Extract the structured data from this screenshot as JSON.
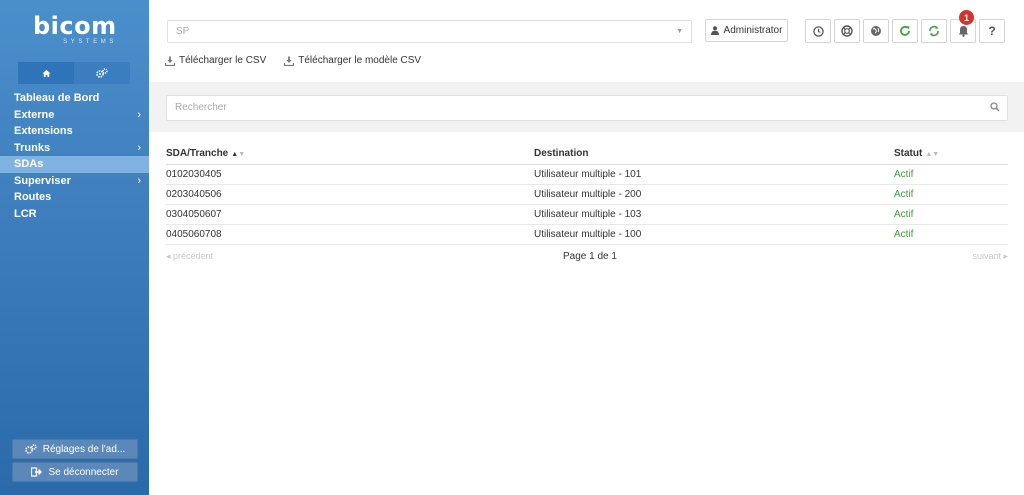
{
  "brand": {
    "name": "bicom",
    "subtitle": "SYSTEMS"
  },
  "sidebar": {
    "tabs": [
      {
        "icon": "home-icon"
      },
      {
        "icon": "gears-icon"
      }
    ],
    "items": [
      {
        "label": "Tableau de Bord",
        "has_children": false,
        "active": false
      },
      {
        "label": "Externe",
        "has_children": true,
        "active": false
      },
      {
        "label": "Extensions",
        "has_children": false,
        "active": false
      },
      {
        "label": "Trunks",
        "has_children": true,
        "active": false
      },
      {
        "label": "SDAs",
        "has_children": false,
        "active": true
      },
      {
        "label": "Superviser",
        "has_children": true,
        "active": false
      },
      {
        "label": "Routes",
        "has_children": false,
        "active": false
      },
      {
        "label": "LCR",
        "has_children": false,
        "active": false
      }
    ],
    "settings_label": "Réglages de l'ad...",
    "logout_label": "Se déconnecter"
  },
  "header": {
    "tenant_value": "SP",
    "admin_label": "Administrator",
    "icons": [
      "clock-icon",
      "lifebuoy-icon",
      "globe-icon",
      "reload-icon",
      "sync-icon",
      "bell-icon",
      "help-icon"
    ],
    "notification_count": "1",
    "help_glyph": "?",
    "download_csv": "Télécharger le CSV",
    "download_template": "Télécharger le modèle CSV"
  },
  "search": {
    "placeholder": "Rechercher"
  },
  "table": {
    "columns": [
      "SDA/Tranche",
      "Destination",
      "Statut"
    ],
    "rows": [
      {
        "sda": "0102030405",
        "destination": "Utilisateur multiple - 101",
        "status": "Actif"
      },
      {
        "sda": "0203040506",
        "destination": "Utilisateur multiple - 200",
        "status": "Actif"
      },
      {
        "sda": "0304050607",
        "destination": "Utilisateur multiple - 103",
        "status": "Actif"
      },
      {
        "sda": "0405060708",
        "destination": "Utilisateur multiple - 100",
        "status": "Actif"
      }
    ]
  },
  "pager": {
    "prev": "précédent",
    "page": "Page 1 de 1",
    "next": "suivant"
  },
  "colors": {
    "sidebar": "#3f7fbd",
    "active_item": "#7fb2e0",
    "status_ok": "#3d9a3d",
    "badge": "#d9312d"
  }
}
